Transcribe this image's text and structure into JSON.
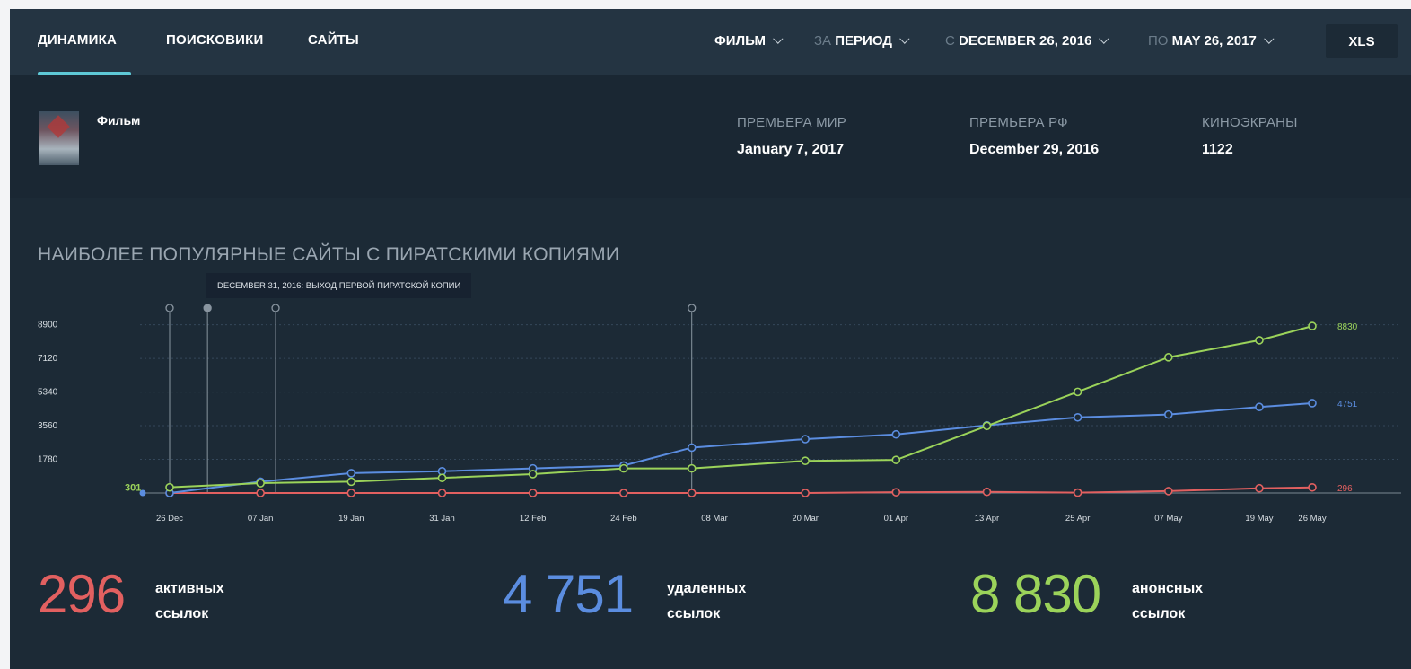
{
  "nav": {
    "tabs": [
      {
        "label": "ДИНАМИКА",
        "active": true
      },
      {
        "label": "ПОИСКОВИКИ",
        "active": false
      },
      {
        "label": "САЙТЫ",
        "active": false
      }
    ],
    "filters": {
      "film": {
        "value": "ФИЛЬМ"
      },
      "period": {
        "prefix": "ЗА",
        "value": "ПЕРИОД"
      },
      "from": {
        "prefix": "С",
        "value": "DECEMBER 26, 2016"
      },
      "to": {
        "prefix": "ПО",
        "value": "MAY 26, 2017"
      }
    },
    "export_label": "XLS"
  },
  "film": {
    "title": "Фильм",
    "meta": [
      {
        "label": "ПРЕМЬЕРА МИР",
        "value": "January 7, 2017"
      },
      {
        "label": "ПРЕМЬЕРА РФ",
        "value": "December 29, 2016"
      },
      {
        "label": "КИНОЭКРАНЫ",
        "value": "1122"
      }
    ]
  },
  "chart_section": {
    "title": "НАИБОЛЕЕ ПОПУЛЯРНЫЕ САЙТЫ С ПИРАТСКИМИ КОПИЯМИ",
    "tooltip": "DECEMBER 31, 2016: ВЫХОД ПЕРВОЙ ПИРАТСКОЙ КОПИИ"
  },
  "chart_data": {
    "type": "line",
    "title": "НАИБОЛЕЕ ПОПУЛЯРНЫЕ САЙТЫ С ПИРАТСКИМИ КОПИЯМИ",
    "x_tick_labels": [
      "26 Dec",
      "07 Jan",
      "19 Jan",
      "31 Jan",
      "12 Feb",
      "24 Feb",
      "08 Mar",
      "20 Mar",
      "01 Apr",
      "13 Apr",
      "25 Apr",
      "07 May",
      "19 May",
      "26 May"
    ],
    "y_ticks": [
      1780,
      3560,
      5340,
      7120,
      8900
    ],
    "ylim": [
      0,
      9500
    ],
    "grid": true,
    "start_label": "301",
    "event_markers": [
      "26 Dec",
      "31 Dec",
      "09 Jan",
      "05 Mar"
    ],
    "series": [
      {
        "color": "#9bd35a",
        "end_label": "8830",
        "points": [
          [
            "26 Dec",
            300
          ],
          [
            "07 Jan",
            520
          ],
          [
            "19 Jan",
            600
          ],
          [
            "31 Jan",
            800
          ],
          [
            "12 Feb",
            1000
          ],
          [
            "24 Feb",
            1300
          ],
          [
            "05 Mar",
            1300
          ],
          [
            "20 Mar",
            1700
          ],
          [
            "01 Apr",
            1750
          ],
          [
            "13 Apr",
            3550
          ],
          [
            "25 Apr",
            5350
          ],
          [
            "07 May",
            7180
          ],
          [
            "19 May",
            8080
          ],
          [
            "26 May",
            8830
          ]
        ]
      },
      {
        "color": "#5b8de0",
        "end_label": "4751",
        "points": [
          [
            "26 Dec",
            0
          ],
          [
            "07 Jan",
            600
          ],
          [
            "19 Jan",
            1050
          ],
          [
            "31 Jan",
            1150
          ],
          [
            "12 Feb",
            1300
          ],
          [
            "24 Feb",
            1450
          ],
          [
            "05 Mar",
            2400
          ],
          [
            "20 Mar",
            2850
          ],
          [
            "01 Apr",
            3100
          ],
          [
            "13 Apr",
            3580
          ],
          [
            "25 Apr",
            4000
          ],
          [
            "07 May",
            4150
          ],
          [
            "19 May",
            4550
          ],
          [
            "26 May",
            4751
          ]
        ]
      },
      {
        "color": "#e26060",
        "end_label": "296",
        "points": [
          [
            "26 Dec",
            0
          ],
          [
            "07 Jan",
            0
          ],
          [
            "19 Jan",
            0
          ],
          [
            "31 Jan",
            0
          ],
          [
            "12 Feb",
            0
          ],
          [
            "24 Feb",
            0
          ],
          [
            "05 Mar",
            0
          ],
          [
            "20 Mar",
            0
          ],
          [
            "01 Apr",
            40
          ],
          [
            "13 Apr",
            60
          ],
          [
            "25 Apr",
            20
          ],
          [
            "07 May",
            100
          ],
          [
            "19 May",
            250
          ],
          [
            "26 May",
            296
          ]
        ]
      }
    ]
  },
  "totals": [
    {
      "value": "296",
      "line1": "активных",
      "line2": "ссылок",
      "color": "#e26060"
    },
    {
      "value": "4 751",
      "line1": "удаленных",
      "line2": "ссылок",
      "color": "#5b8de0"
    },
    {
      "value": "8 830",
      "line1": "анонсных",
      "line2": "ссылок",
      "color": "#9bd35a"
    }
  ]
}
